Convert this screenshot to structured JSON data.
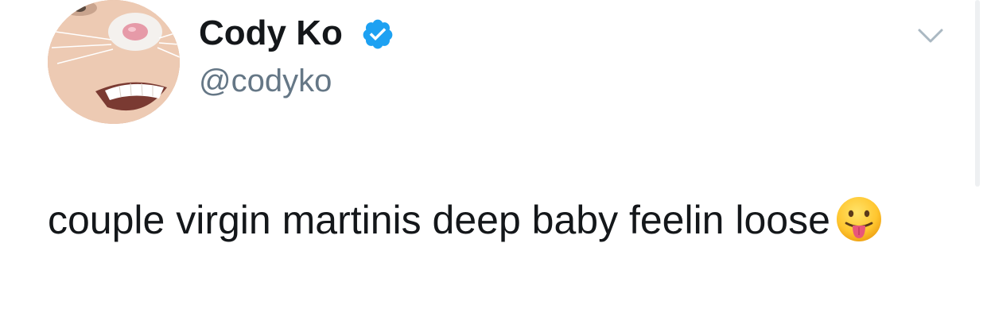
{
  "tweet": {
    "display_name": "Cody Ko",
    "handle": "@codyko",
    "verified": true,
    "text": "couple virgin martinis deep baby feelin loose",
    "emoji": "tongue-out-face-emoji"
  },
  "colors": {
    "text_primary": "#14171a",
    "text_secondary": "#657786",
    "verified_blue": "#1da1f2",
    "chevron_gray": "#aab8c2"
  }
}
